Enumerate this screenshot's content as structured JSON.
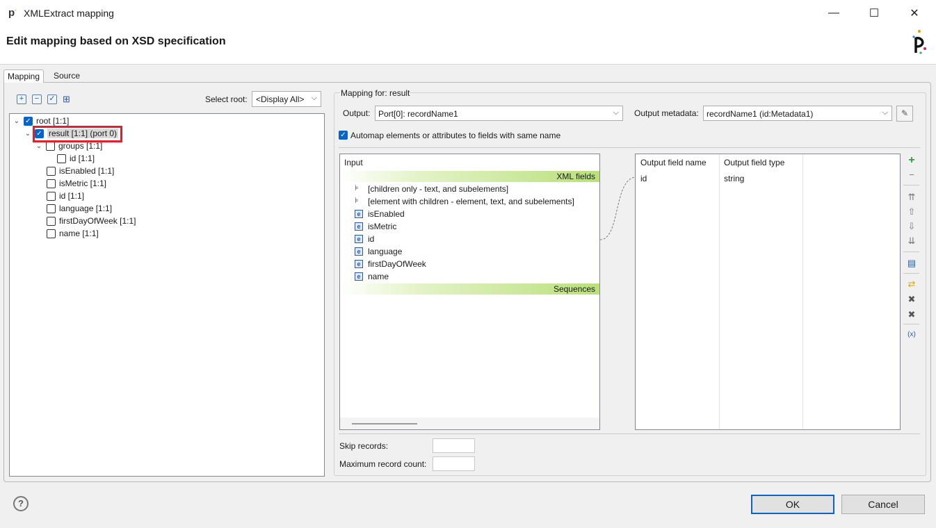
{
  "window": {
    "title": "XMLExtract mapping",
    "minimize_glyph": "—",
    "maximize_glyph": "☐",
    "close_glyph": "✕",
    "app_icon": "p-logo-icon"
  },
  "header": {
    "heading": "Edit mapping based on XSD specification"
  },
  "tabs": [
    {
      "label": "Mapping",
      "active": true
    },
    {
      "label": "Source",
      "active": false
    }
  ],
  "left": {
    "toolbar_icons": [
      "expand-all-icon",
      "collapse-all-icon",
      "check-icon",
      "hierarchy-icon"
    ],
    "select_root_label": "Select root:",
    "select_root_value": "<Display All>",
    "tree": [
      {
        "label": "root [1:1]",
        "checked": true,
        "expanded": true
      },
      {
        "label": "result [1:1] (port 0)",
        "checked": true,
        "expanded": true,
        "highlighted": true
      },
      {
        "label": "groups [1:1]",
        "checked": false,
        "expanded": true
      },
      {
        "label": "id [1:1]",
        "checked": false
      },
      {
        "label": "isEnabled [1:1]",
        "checked": false
      },
      {
        "label": "isMetric [1:1]",
        "checked": false
      },
      {
        "label": "id [1:1]",
        "checked": false
      },
      {
        "label": "language [1:1]",
        "checked": false
      },
      {
        "label": "firstDayOfWeek [1:1]",
        "checked": false
      },
      {
        "label": "name [1:1]",
        "checked": false
      }
    ]
  },
  "mapping": {
    "group_label": "Mapping for: result",
    "output_label": "Output:",
    "output_value": "Port[0]: recordName1",
    "output_metadata_label": "Output metadata:",
    "output_metadata_value": "recordName1 (id:Metadata1)",
    "automap_label": "Automap elements or attributes to fields with same name",
    "automap_checked": true,
    "input": {
      "header": "Input",
      "xml_fields_label": "XML fields",
      "sequences_label": "Sequences",
      "fields": [
        {
          "icon": "subtree-icon",
          "label": "[children only - text, and subelements]"
        },
        {
          "icon": "subtree-icon",
          "label": "[element with children - element, text, and subelements]"
        },
        {
          "icon": "element-icon",
          "label": "isEnabled"
        },
        {
          "icon": "element-icon",
          "label": "isMetric"
        },
        {
          "icon": "element-icon",
          "label": "id"
        },
        {
          "icon": "element-icon",
          "label": "language"
        },
        {
          "icon": "element-icon",
          "label": "firstDayOfWeek"
        },
        {
          "icon": "element-icon",
          "label": "name"
        }
      ]
    },
    "output_table": {
      "columns": [
        "Output field name",
        "Output field type"
      ],
      "rows": [
        {
          "name": "id",
          "type": "string"
        }
      ]
    },
    "side_buttons": [
      "add-icon",
      "remove-icon",
      "move-top-icon",
      "move-up-icon",
      "move-down-icon",
      "move-bottom-icon",
      "edit-field-icon",
      "refresh-mapping-icon",
      "delete-icon",
      "delete-all-icon",
      "variable-icon"
    ],
    "skip_records_label": "Skip records:",
    "skip_records_value": "",
    "max_record_label": "Maximum record count:",
    "max_record_value": ""
  },
  "footer": {
    "help_glyph": "?",
    "ok_label": "OK",
    "cancel_label": "Cancel"
  },
  "colors": {
    "accent": "#0a64c8",
    "highlight_border": "#e0202a",
    "xml_bar": "#b9e07a"
  }
}
